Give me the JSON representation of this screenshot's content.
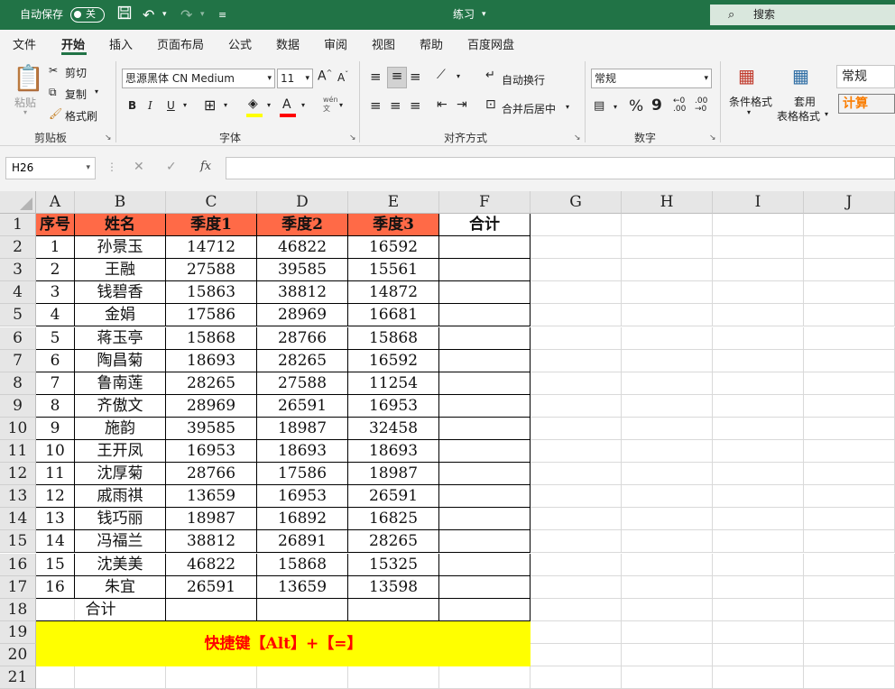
{
  "titlebar": {
    "autosave_label": "自动保存",
    "autosave_state": "关",
    "doc_title": "练习",
    "search_placeholder": "搜索"
  },
  "tabs": [
    "文件",
    "开始",
    "插入",
    "页面布局",
    "公式",
    "数据",
    "审阅",
    "视图",
    "帮助",
    "百度网盘"
  ],
  "active_tab": "开始",
  "ribbon": {
    "clipboard": {
      "paste": "粘贴",
      "cut": "剪切",
      "copy": "复制",
      "format_painter": "格式刷",
      "group": "剪贴板"
    },
    "font": {
      "name": "思源黑体 CN Medium",
      "size": "11",
      "group": "字体",
      "bold": "B",
      "italic": "I",
      "underline": "U",
      "grow": "A",
      "shrink": "A",
      "phonetic": "wén"
    },
    "alignment": {
      "wrap": "自动换行",
      "merge": "合并后居中",
      "group": "对齐方式"
    },
    "number": {
      "format": "常规",
      "percent": "%",
      "comma": "9",
      "group": "数字"
    },
    "styles": {
      "cond_format": "条件格式",
      "table_format_1": "套用",
      "table_format_2": "表格格式",
      "style_normal": "常规",
      "style_calc": "计算"
    }
  },
  "formula_bar": {
    "name_box": "H26",
    "fx": "fx",
    "value": ""
  },
  "columns": [
    "A",
    "B",
    "C",
    "D",
    "E",
    "F",
    "G",
    "H",
    "I",
    "J"
  ],
  "rows": [
    "1",
    "2",
    "3",
    "4",
    "5",
    "6",
    "7",
    "8",
    "9",
    "10",
    "11",
    "12",
    "13",
    "14",
    "15",
    "16",
    "17",
    "18",
    "19",
    "20",
    "21"
  ],
  "table": {
    "headers": [
      "序号",
      "姓名",
      "季度1",
      "季度2",
      "季度3",
      "合计"
    ],
    "rows": [
      [
        "1",
        "孙景玉",
        "14712",
        "46822",
        "16592"
      ],
      [
        "2",
        "王融",
        "27588",
        "39585",
        "15561"
      ],
      [
        "3",
        "钱碧香",
        "15863",
        "38812",
        "14872"
      ],
      [
        "4",
        "金娟",
        "17586",
        "28969",
        "16681"
      ],
      [
        "5",
        "蒋玉亭",
        "15868",
        "28766",
        "15868"
      ],
      [
        "6",
        "陶昌菊",
        "18693",
        "28265",
        "16592"
      ],
      [
        "7",
        "鲁南莲",
        "28265",
        "27588",
        "11254"
      ],
      [
        "8",
        "齐傲文",
        "28969",
        "26591",
        "16953"
      ],
      [
        "9",
        "施韵",
        "39585",
        "18987",
        "32458"
      ],
      [
        "10",
        "王开凤",
        "16953",
        "18693",
        "18693"
      ],
      [
        "11",
        "沈厚菊",
        "28766",
        "17586",
        "18987"
      ],
      [
        "12",
        "戚雨祺",
        "13659",
        "16953",
        "26591"
      ],
      [
        "13",
        "钱巧丽",
        "18987",
        "16892",
        "16825"
      ],
      [
        "14",
        "冯福兰",
        "38812",
        "26891",
        "28265"
      ],
      [
        "15",
        "沈美美",
        "46822",
        "15868",
        "15325"
      ],
      [
        "16",
        "朱宜",
        "26591",
        "13659",
        "13598"
      ]
    ],
    "total_label": "合计"
  },
  "note": "快捷键【Alt】+【=】",
  "colors": {
    "excel_green": "#217346",
    "header_fill": "#ff6a47",
    "note_fill": "#ffff00",
    "note_text": "#ff0000"
  }
}
